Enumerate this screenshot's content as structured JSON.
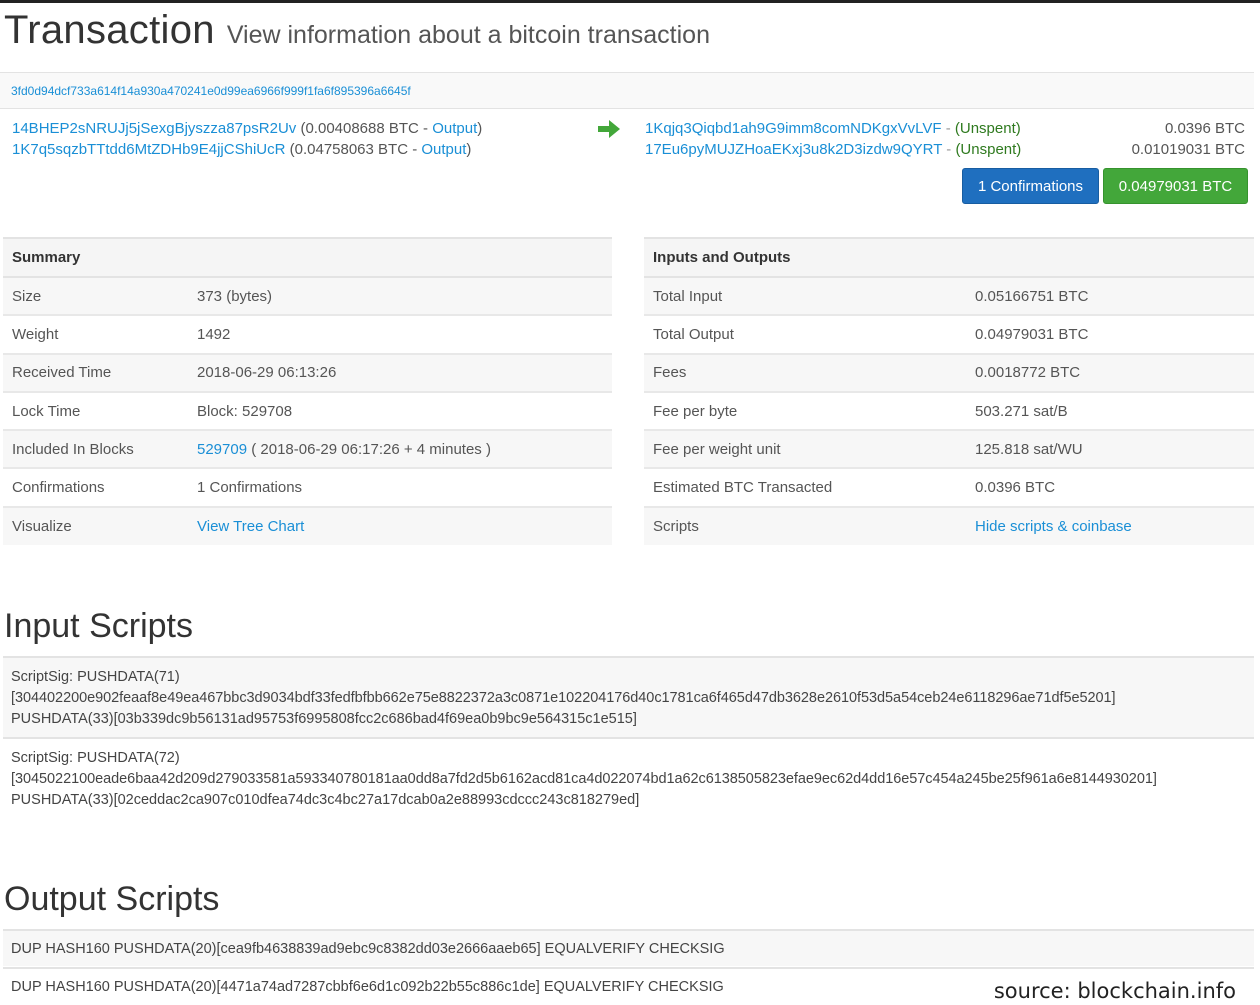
{
  "header": {
    "title": "Transaction",
    "subtitle": "View information about a bitcoin transaction"
  },
  "tx_hash": "3fd0d94dcf733a614f14a930a470241e0d99ea6966f999f1fa6f895396a6645f",
  "inputs": [
    {
      "address": "14BHEP2sNRUJj5jSexgBjyszza87psR2Uv",
      "amount_prefix": "(0.00408688 BTC - ",
      "link": "Output",
      "suffix": ")"
    },
    {
      "address": "1K7q5sqzbTTtdd6MtZDHb9E4jjCShiUcR",
      "amount_prefix": "(0.04758063 BTC - ",
      "link": "Output",
      "suffix": ")"
    }
  ],
  "outputs": [
    {
      "address": "1Kqjq3Qiqbd1ah9G9imm8comNDKgxVvLVF",
      "sep": " - ",
      "status": "(Unspent)",
      "amount": "0.0396 BTC"
    },
    {
      "address": "17Eu6pyMUJZHoaEKxj3u8k2D3izdw9QYRT",
      "sep": " - ",
      "status": "(Unspent)",
      "amount": "0.01019031 BTC"
    }
  ],
  "buttons": {
    "confirmations": "1 Confirmations",
    "total": "0.04979031 BTC"
  },
  "summary": {
    "heading": "Summary",
    "rows": {
      "size": {
        "label": "Size",
        "value": "373 (bytes)"
      },
      "weight": {
        "label": "Weight",
        "value": "1492"
      },
      "received": {
        "label": "Received Time",
        "value": "2018-06-29 06:13:26"
      },
      "lock": {
        "label": "Lock Time",
        "value": "Block: 529708"
      },
      "included": {
        "label": "Included In Blocks",
        "link": "529709",
        "value": " ( 2018-06-29 06:17:26 + 4 minutes )"
      },
      "confirmations": {
        "label": "Confirmations",
        "value": "1 Confirmations"
      },
      "visualize": {
        "label": "Visualize",
        "link": "View Tree Chart"
      }
    }
  },
  "io": {
    "heading": "Inputs and Outputs",
    "rows": {
      "total_input": {
        "label": "Total Input",
        "value": "0.05166751 BTC"
      },
      "total_output": {
        "label": "Total Output",
        "value": "0.04979031 BTC"
      },
      "fees": {
        "label": "Fees",
        "value": "0.0018772 BTC"
      },
      "fee_byte": {
        "label": "Fee per byte",
        "value": "503.271 sat/B"
      },
      "fee_wu": {
        "label": "Fee per weight unit",
        "value": "125.818 sat/WU"
      },
      "estimated": {
        "label": "Estimated BTC Transacted",
        "value": "0.0396 BTC"
      },
      "scripts": {
        "label": "Scripts",
        "link": "Hide scripts & coinbase"
      }
    }
  },
  "input_scripts": {
    "heading": "Input Scripts",
    "items": [
      {
        "line1": "ScriptSig: PUSHDATA(71)",
        "line2": "[304402200e902feaaf8e49ea467bbc3d9034bdf33fedfbfbb662e75e8822372a3c0871e102204176d40c1781ca6f465d47db3628e2610f53d5a54ceb24e6118296ae71df5e5201]",
        "line3": "PUSHDATA(33)[03b339dc9b56131ad95753f6995808fcc2c686bad4f69ea0b9bc9e564315c1e515]"
      },
      {
        "line1": "ScriptSig: PUSHDATA(72)",
        "line2": "[3045022100eade6baa42d209d279033581a593340780181aa0dd8a7fd2d5b6162acd81ca4d022074bd1a62c6138505823efae9ec62d4dd16e57c454a245be25f961a6e8144930201]",
        "line3": "PUSHDATA(33)[02ceddac2ca907c010dfea74dc3c4bc27a17dcab0a2e88993cdccc243c818279ed]"
      }
    ]
  },
  "output_scripts": {
    "heading": "Output Scripts",
    "items": [
      "DUP HASH160 PUSHDATA(20)[cea9fb4638839ad9ebc9c8382dd03e2666aaeb65] EQUALVERIFY CHECKSIG",
      "DUP HASH160 PUSHDATA(20)[4471a74ad7287cbbf6e6d1c092b22b55c886c1de] EQUALVERIFY CHECKSIG"
    ]
  },
  "source": "source: blockchain.info",
  "colors": {
    "link": "#1a8fd6",
    "unspent": "#2f7a1f",
    "arrow": "#43a73a",
    "btn_blue": "#1f6fbf",
    "btn_green": "#43a73a"
  },
  "icons": {
    "arrow": "arrow-right-icon"
  }
}
